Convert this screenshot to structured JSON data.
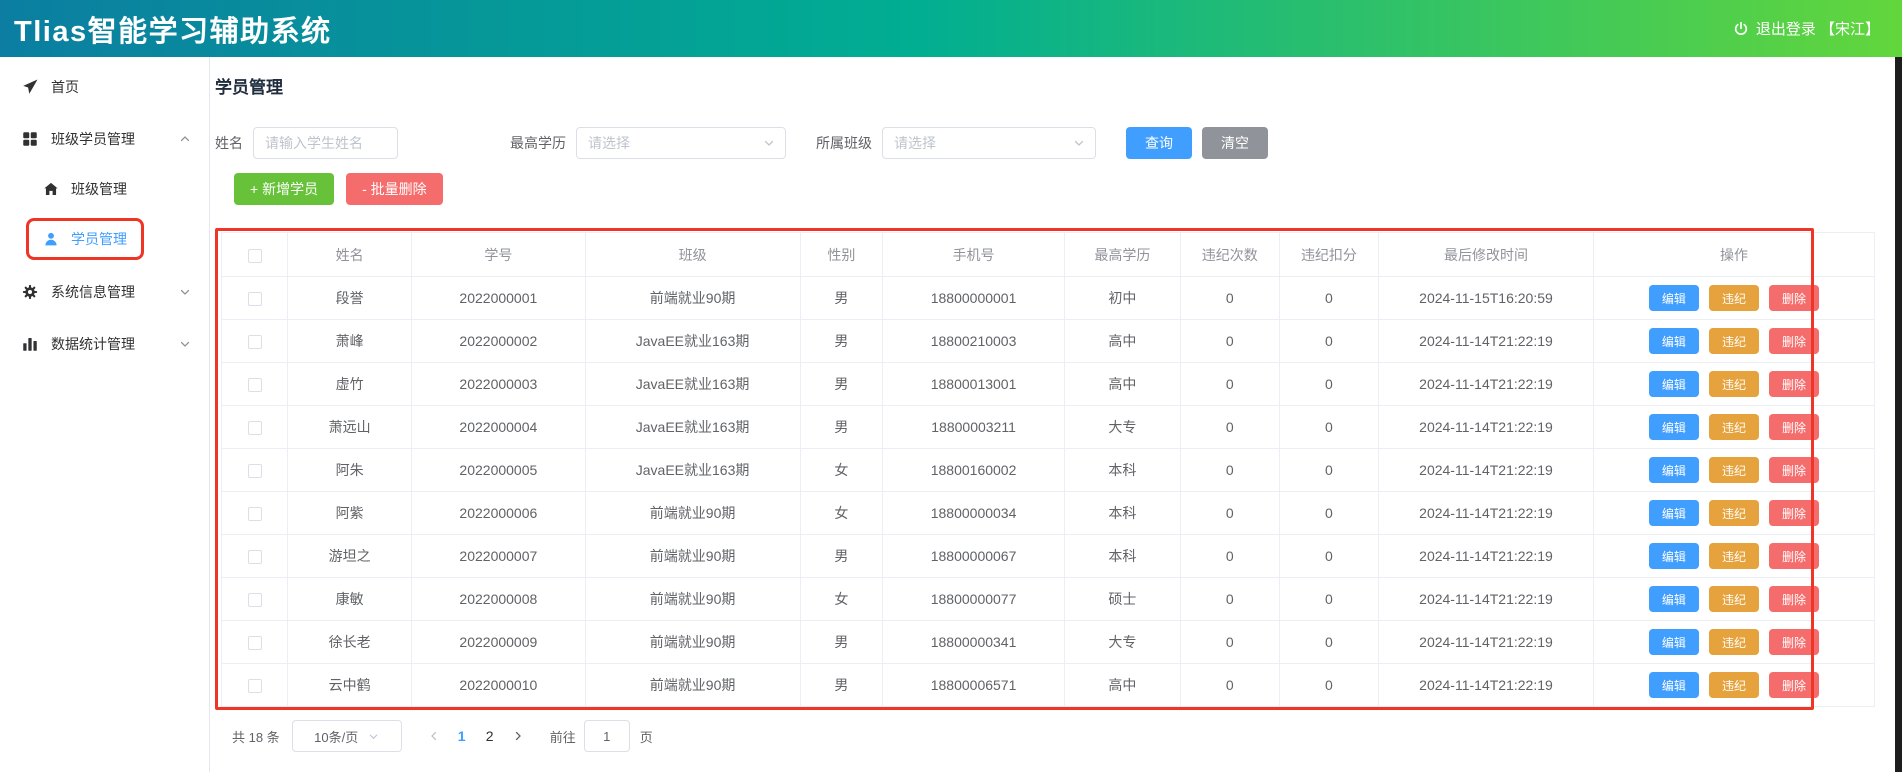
{
  "header": {
    "title": "Tlias智能学习辅助系统",
    "logout_label": "退出登录 【宋江】"
  },
  "sidebar": {
    "items": [
      {
        "label": "首页",
        "icon": "send-icon"
      },
      {
        "label": "班级学员管理",
        "icon": "grid-icon",
        "chevron": "up"
      },
      {
        "label": "班级管理",
        "icon": "house-icon",
        "sub": true
      },
      {
        "label": "学员管理",
        "icon": "user-icon",
        "sub": true,
        "active": true,
        "annotated": true
      },
      {
        "label": "系统信息管理",
        "icon": "gear-icon",
        "chevron": "down"
      },
      {
        "label": "数据统计管理",
        "icon": "bar-chart-icon",
        "chevron": "down"
      }
    ]
  },
  "page": {
    "title": "学员管理"
  },
  "filters": {
    "name_label": "姓名",
    "name_placeholder": "请输入学生姓名",
    "degree_label": "最高学历",
    "degree_placeholder": "请选择",
    "clazz_label": "所属班级",
    "clazz_placeholder": "请选择",
    "search_button": "查询",
    "clear_button": "清空"
  },
  "toolbar": {
    "add_button": "+ 新增学员",
    "batch_delete_button": "- 批量删除"
  },
  "table": {
    "headers": [
      "姓名",
      "学号",
      "班级",
      "性别",
      "手机号",
      "最高学历",
      "违纪次数",
      "违纪扣分",
      "最后修改时间",
      "操作"
    ],
    "actions": [
      "编辑",
      "违纪",
      "删除"
    ],
    "rows": [
      [
        "段誉",
        "2022000001",
        "前端就业90期",
        "男",
        "18800000001",
        "初中",
        "0",
        "0",
        "2024-11-15T16:20:59"
      ],
      [
        "萧峰",
        "2022000002",
        "JavaEE就业163期",
        "男",
        "18800210003",
        "高中",
        "0",
        "0",
        "2024-11-14T21:22:19"
      ],
      [
        "虚竹",
        "2022000003",
        "JavaEE就业163期",
        "男",
        "18800013001",
        "高中",
        "0",
        "0",
        "2024-11-14T21:22:19"
      ],
      [
        "萧远山",
        "2022000004",
        "JavaEE就业163期",
        "男",
        "18800003211",
        "大专",
        "0",
        "0",
        "2024-11-14T21:22:19"
      ],
      [
        "阿朱",
        "2022000005",
        "JavaEE就业163期",
        "女",
        "18800160002",
        "本科",
        "0",
        "0",
        "2024-11-14T21:22:19"
      ],
      [
        "阿紫",
        "2022000006",
        "前端就业90期",
        "女",
        "18800000034",
        "本科",
        "0",
        "0",
        "2024-11-14T21:22:19"
      ],
      [
        "游坦之",
        "2022000007",
        "前端就业90期",
        "男",
        "18800000067",
        "本科",
        "0",
        "0",
        "2024-11-14T21:22:19"
      ],
      [
        "康敏",
        "2022000008",
        "前端就业90期",
        "女",
        "18800000077",
        "硕士",
        "0",
        "0",
        "2024-11-14T21:22:19"
      ],
      [
        "徐长老",
        "2022000009",
        "前端就业90期",
        "男",
        "18800000341",
        "大专",
        "0",
        "0",
        "2024-11-14T21:22:19"
      ],
      [
        "云中鹤",
        "2022000010",
        "前端就业90期",
        "男",
        "18800006571",
        "高中",
        "0",
        "0",
        "2024-11-14T21:22:19"
      ]
    ]
  },
  "pagination": {
    "total_label": "共 18 条",
    "page_size": "10条/页",
    "pages": [
      "1",
      "2"
    ],
    "active_page": "1",
    "goto_label": "前往",
    "goto_value": "1",
    "goto_suffix": "页"
  },
  "colors": {
    "accent": "#409eff",
    "success": "#67c23a",
    "danger": "#f56c6c",
    "warning": "#e6a23c",
    "info": "#909399",
    "annotation_red": "#ee3526",
    "header_gradient_left": "#0b7ea1",
    "header_gradient_mid": "#01ae92",
    "header_gradient_right": "#62d63c"
  }
}
